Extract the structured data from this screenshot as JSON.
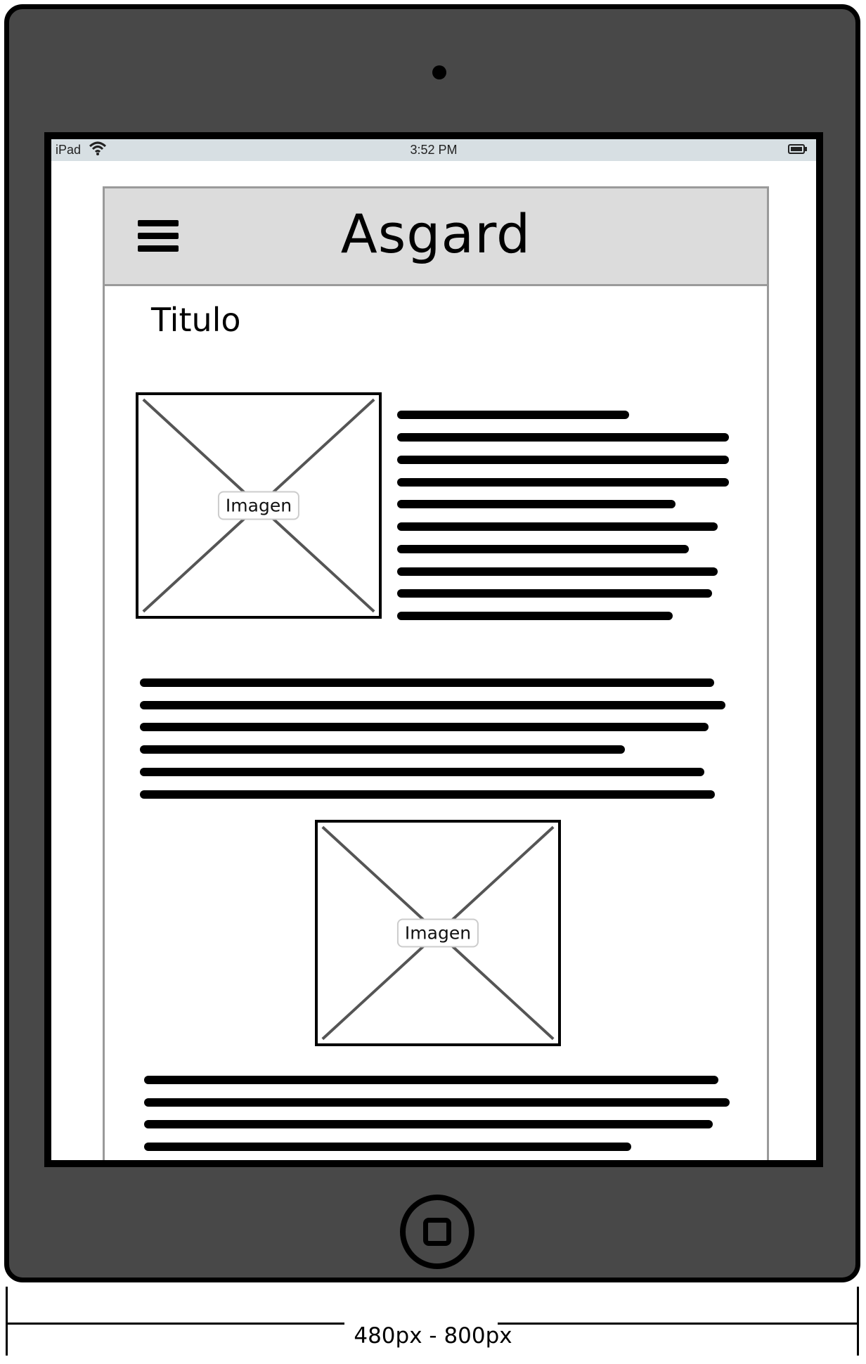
{
  "status_bar": {
    "carrier": "iPad",
    "time": "3:52 PM"
  },
  "app": {
    "title": "Asgard"
  },
  "content": {
    "heading": "Titulo",
    "images": [
      {
        "label": "Imagen"
      },
      {
        "label": "Imagen"
      }
    ],
    "paragraph_lines": [
      6,
      10,
      6,
      4
    ]
  },
  "dimension_label": "480px - 800px"
}
